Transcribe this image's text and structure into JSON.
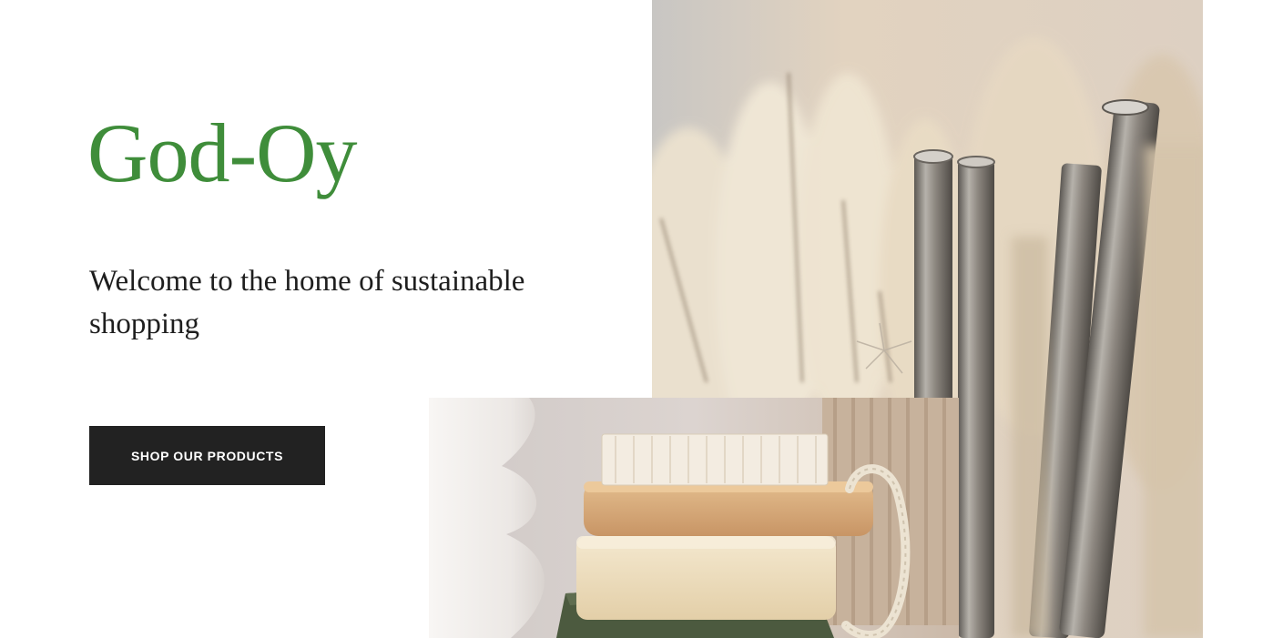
{
  "hero": {
    "title": "God-Oy",
    "tagline": "Welcome to the home of sustainable shopping",
    "cta_label": "SHOP OUR PRODUCTS"
  },
  "colors": {
    "title": "#3f8d3a",
    "button_bg": "#222222",
    "button_text": "#ffffff",
    "text": "#1e1e1e"
  }
}
